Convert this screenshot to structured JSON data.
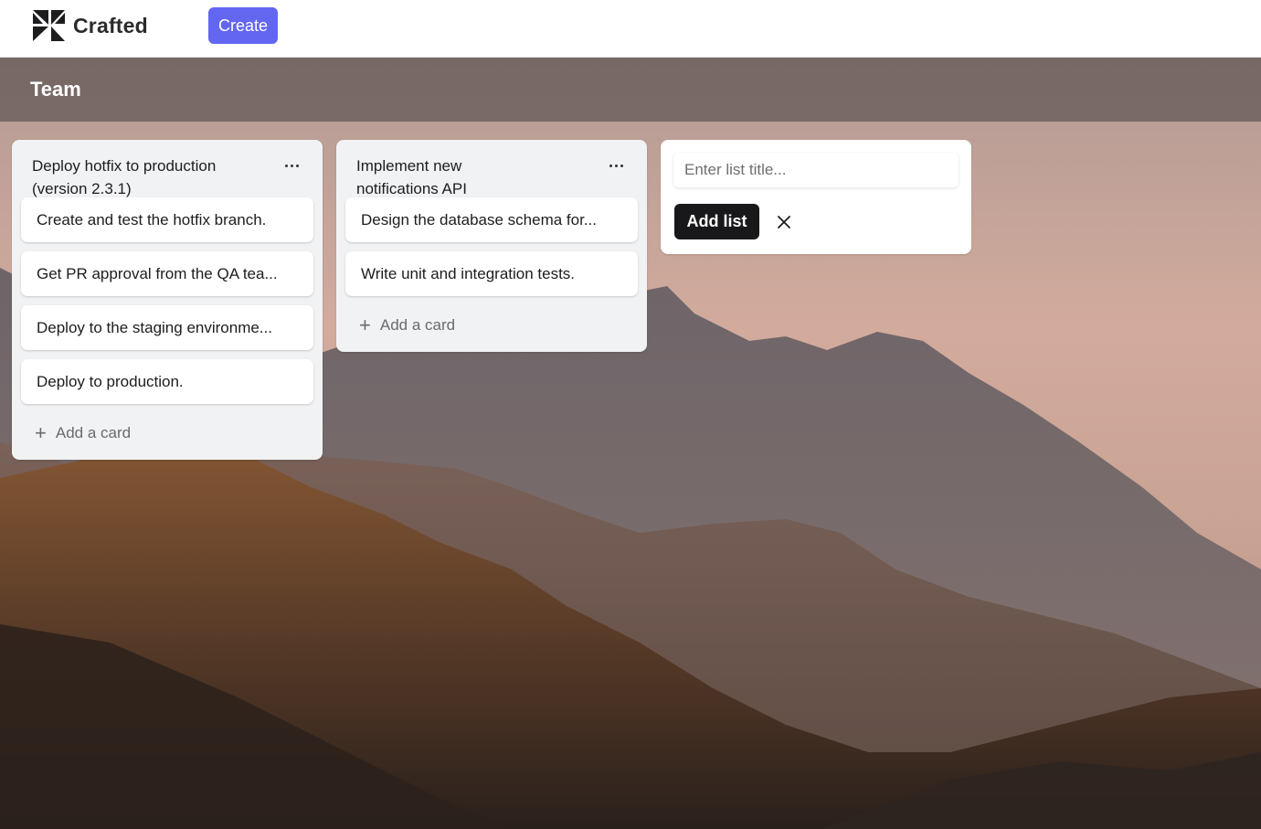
{
  "header": {
    "brand_name": "Crafted",
    "create_label": "Create"
  },
  "board": {
    "title": "Team"
  },
  "lists": [
    {
      "title": "Deploy hotfix to production (version 2.3.1)",
      "cards": [
        "Create and test the hotfix branch.",
        "Get PR approval from the QA tea...",
        "Deploy to the staging environme...",
        "Deploy to production."
      ],
      "add_card_label": "Add a card"
    },
    {
      "title": "Implement new notifications API",
      "cards": [
        "Design the database schema for...",
        "Write unit and integration tests."
      ],
      "add_card_label": "Add a card"
    }
  ],
  "new_list": {
    "placeholder": "Enter list title...",
    "value": "",
    "add_list_label": "Add list"
  },
  "icons": {
    "logo": "crafted-logo-icon",
    "list_menu": "ellipsis-icon",
    "add": "plus-icon",
    "close": "close-icon"
  },
  "colors": {
    "accent": "#6366f1",
    "primary_dark": "#18181b",
    "list_bg": "#f1f2f4"
  }
}
